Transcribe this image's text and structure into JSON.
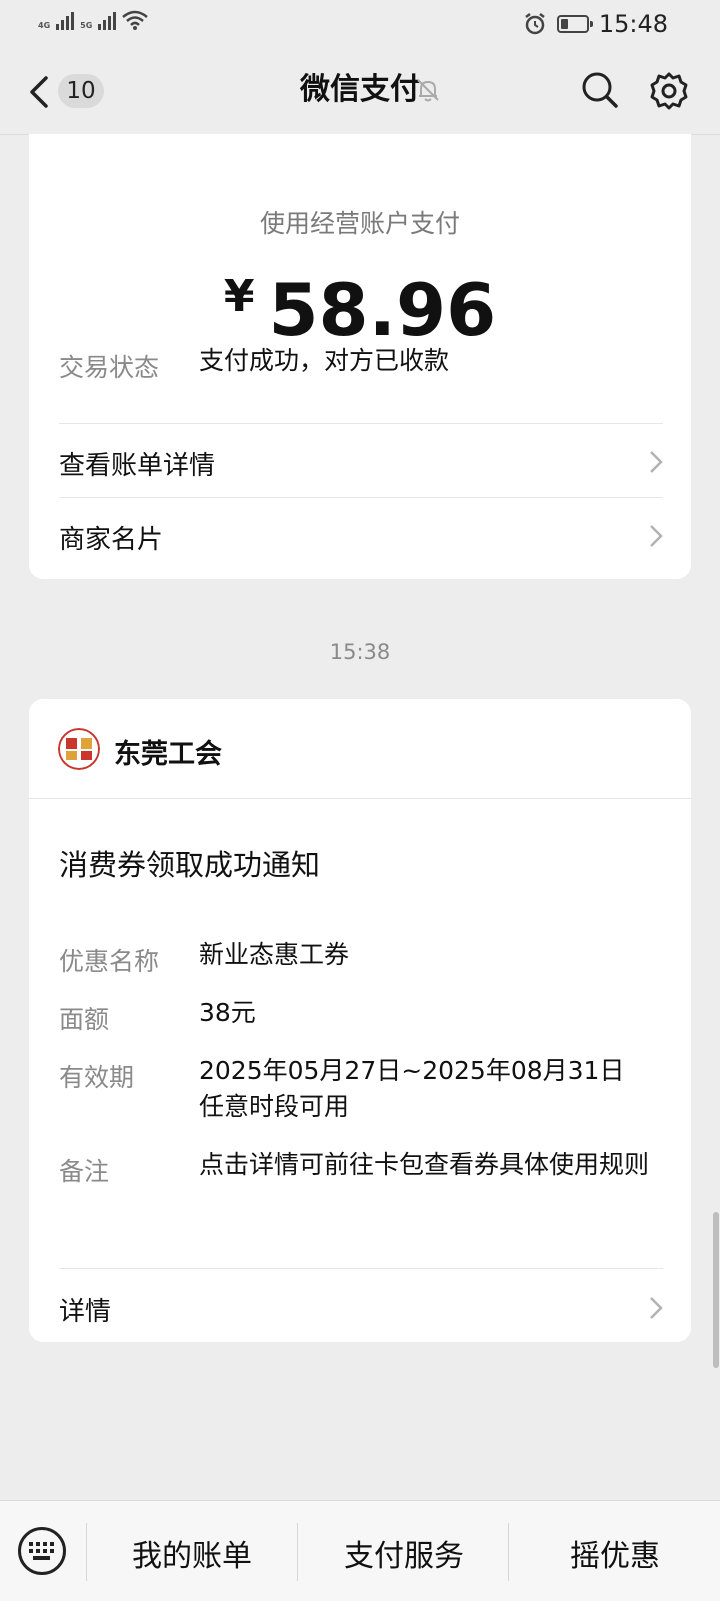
{
  "status_bar": {
    "net1": "4G",
    "net2": "5G",
    "time": "15:48"
  },
  "nav": {
    "unread_count": "10",
    "title": "微信支付"
  },
  "payment_card": {
    "subtitle": "使用经营账户支付",
    "currency_symbol": "¥",
    "amount": "58.96",
    "status_label": "交易状态",
    "status_value": "支付成功，对方已收款",
    "rows": [
      {
        "label": "查看账单详情"
      },
      {
        "label": "商家名片"
      }
    ]
  },
  "timestamp": "15:38",
  "voucher_card": {
    "org_name": "东莞工会",
    "notice_title": "消费券领取成功通知",
    "fields": [
      {
        "label": "优惠名称",
        "value": "新业态惠工券"
      },
      {
        "label": "面额",
        "value": "38元"
      },
      {
        "label": "有效期",
        "value": "2025年05月27日~2025年08月31日任意时段可用"
      },
      {
        "label": "备注",
        "value": "点击详情可前往卡包查看券具体使用规则"
      }
    ],
    "details_label": "详情"
  },
  "bottom_menu": {
    "items": [
      "我的账单",
      "支付服务",
      "摇优惠"
    ]
  },
  "colors": {
    "background": "#ededed",
    "card": "#ffffff",
    "muted_text": "#8a8a8a"
  }
}
